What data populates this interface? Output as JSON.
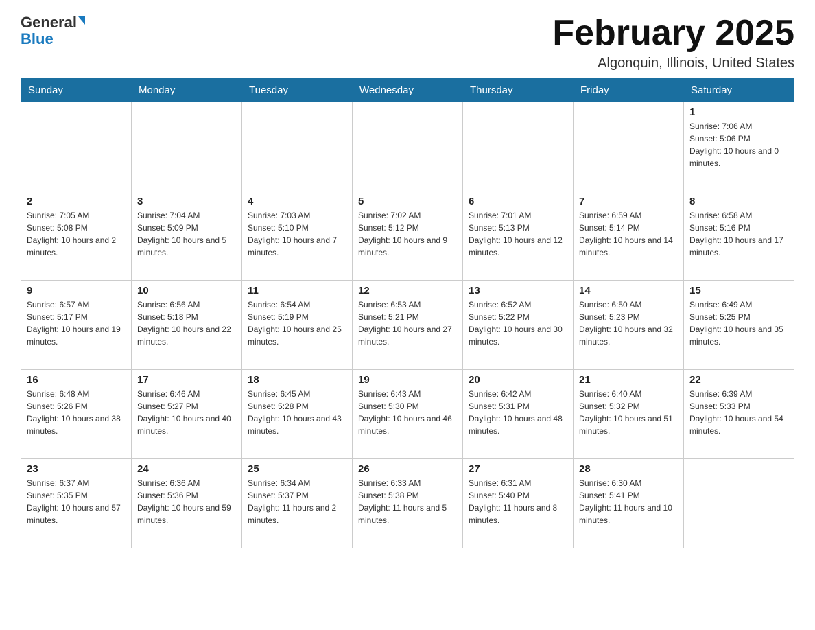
{
  "header": {
    "logo_general": "General",
    "logo_blue": "Blue",
    "month_title": "February 2025",
    "location": "Algonquin, Illinois, United States"
  },
  "days_of_week": [
    "Sunday",
    "Monday",
    "Tuesday",
    "Wednesday",
    "Thursday",
    "Friday",
    "Saturday"
  ],
  "weeks": [
    [
      {
        "day": "",
        "info": ""
      },
      {
        "day": "",
        "info": ""
      },
      {
        "day": "",
        "info": ""
      },
      {
        "day": "",
        "info": ""
      },
      {
        "day": "",
        "info": ""
      },
      {
        "day": "",
        "info": ""
      },
      {
        "day": "1",
        "info": "Sunrise: 7:06 AM\nSunset: 5:06 PM\nDaylight: 10 hours and 0 minutes."
      }
    ],
    [
      {
        "day": "2",
        "info": "Sunrise: 7:05 AM\nSunset: 5:08 PM\nDaylight: 10 hours and 2 minutes."
      },
      {
        "day": "3",
        "info": "Sunrise: 7:04 AM\nSunset: 5:09 PM\nDaylight: 10 hours and 5 minutes."
      },
      {
        "day": "4",
        "info": "Sunrise: 7:03 AM\nSunset: 5:10 PM\nDaylight: 10 hours and 7 minutes."
      },
      {
        "day": "5",
        "info": "Sunrise: 7:02 AM\nSunset: 5:12 PM\nDaylight: 10 hours and 9 minutes."
      },
      {
        "day": "6",
        "info": "Sunrise: 7:01 AM\nSunset: 5:13 PM\nDaylight: 10 hours and 12 minutes."
      },
      {
        "day": "7",
        "info": "Sunrise: 6:59 AM\nSunset: 5:14 PM\nDaylight: 10 hours and 14 minutes."
      },
      {
        "day": "8",
        "info": "Sunrise: 6:58 AM\nSunset: 5:16 PM\nDaylight: 10 hours and 17 minutes."
      }
    ],
    [
      {
        "day": "9",
        "info": "Sunrise: 6:57 AM\nSunset: 5:17 PM\nDaylight: 10 hours and 19 minutes."
      },
      {
        "day": "10",
        "info": "Sunrise: 6:56 AM\nSunset: 5:18 PM\nDaylight: 10 hours and 22 minutes."
      },
      {
        "day": "11",
        "info": "Sunrise: 6:54 AM\nSunset: 5:19 PM\nDaylight: 10 hours and 25 minutes."
      },
      {
        "day": "12",
        "info": "Sunrise: 6:53 AM\nSunset: 5:21 PM\nDaylight: 10 hours and 27 minutes."
      },
      {
        "day": "13",
        "info": "Sunrise: 6:52 AM\nSunset: 5:22 PM\nDaylight: 10 hours and 30 minutes."
      },
      {
        "day": "14",
        "info": "Sunrise: 6:50 AM\nSunset: 5:23 PM\nDaylight: 10 hours and 32 minutes."
      },
      {
        "day": "15",
        "info": "Sunrise: 6:49 AM\nSunset: 5:25 PM\nDaylight: 10 hours and 35 minutes."
      }
    ],
    [
      {
        "day": "16",
        "info": "Sunrise: 6:48 AM\nSunset: 5:26 PM\nDaylight: 10 hours and 38 minutes."
      },
      {
        "day": "17",
        "info": "Sunrise: 6:46 AM\nSunset: 5:27 PM\nDaylight: 10 hours and 40 minutes."
      },
      {
        "day": "18",
        "info": "Sunrise: 6:45 AM\nSunset: 5:28 PM\nDaylight: 10 hours and 43 minutes."
      },
      {
        "day": "19",
        "info": "Sunrise: 6:43 AM\nSunset: 5:30 PM\nDaylight: 10 hours and 46 minutes."
      },
      {
        "day": "20",
        "info": "Sunrise: 6:42 AM\nSunset: 5:31 PM\nDaylight: 10 hours and 48 minutes."
      },
      {
        "day": "21",
        "info": "Sunrise: 6:40 AM\nSunset: 5:32 PM\nDaylight: 10 hours and 51 minutes."
      },
      {
        "day": "22",
        "info": "Sunrise: 6:39 AM\nSunset: 5:33 PM\nDaylight: 10 hours and 54 minutes."
      }
    ],
    [
      {
        "day": "23",
        "info": "Sunrise: 6:37 AM\nSunset: 5:35 PM\nDaylight: 10 hours and 57 minutes."
      },
      {
        "day": "24",
        "info": "Sunrise: 6:36 AM\nSunset: 5:36 PM\nDaylight: 10 hours and 59 minutes."
      },
      {
        "day": "25",
        "info": "Sunrise: 6:34 AM\nSunset: 5:37 PM\nDaylight: 11 hours and 2 minutes."
      },
      {
        "day": "26",
        "info": "Sunrise: 6:33 AM\nSunset: 5:38 PM\nDaylight: 11 hours and 5 minutes."
      },
      {
        "day": "27",
        "info": "Sunrise: 6:31 AM\nSunset: 5:40 PM\nDaylight: 11 hours and 8 minutes."
      },
      {
        "day": "28",
        "info": "Sunrise: 6:30 AM\nSunset: 5:41 PM\nDaylight: 11 hours and 10 minutes."
      },
      {
        "day": "",
        "info": ""
      }
    ]
  ]
}
